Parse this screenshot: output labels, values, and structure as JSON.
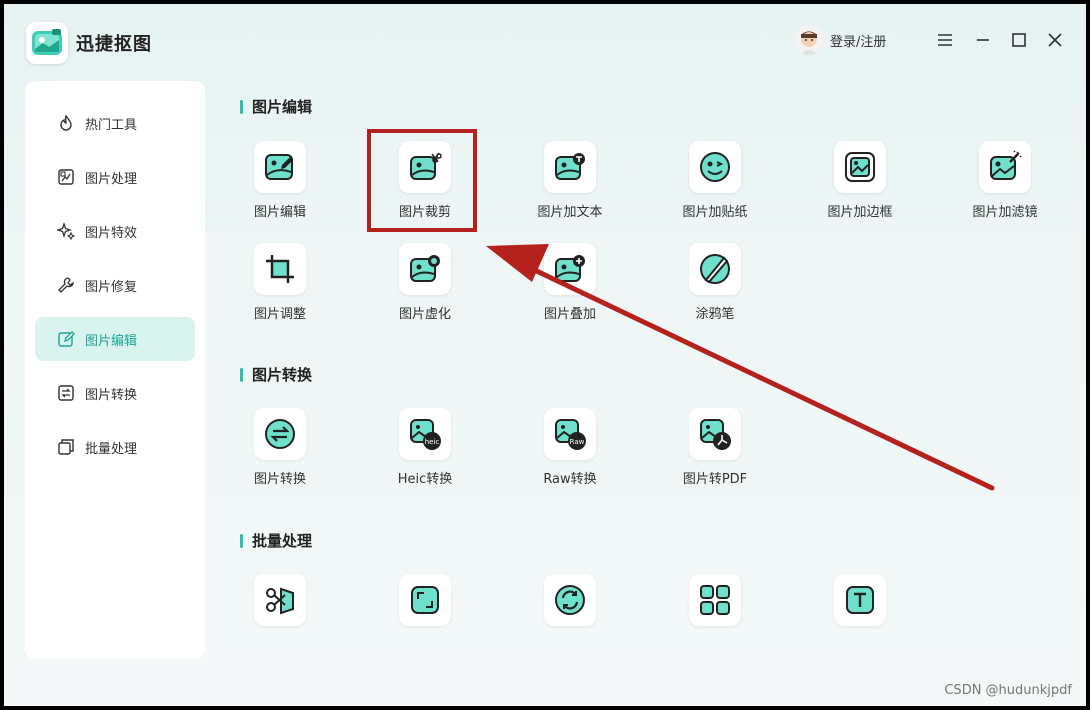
{
  "app": {
    "title": "迅捷抠图"
  },
  "header": {
    "login_label": "登录/注册"
  },
  "sidebar": {
    "items": [
      {
        "label": "热门工具",
        "icon": "flame-icon"
      },
      {
        "label": "图片处理",
        "icon": "image-process-icon"
      },
      {
        "label": "图片特效",
        "icon": "sparkle-icon"
      },
      {
        "label": "图片修复",
        "icon": "wrench-icon"
      },
      {
        "label": "图片编辑",
        "icon": "edit-icon",
        "active": true
      },
      {
        "label": "图片转换",
        "icon": "convert-icon"
      },
      {
        "label": "批量处理",
        "icon": "batch-icon"
      }
    ]
  },
  "sections": [
    {
      "title": "图片编辑",
      "tools": [
        {
          "label": "图片编辑",
          "icon": "image-edit-icon"
        },
        {
          "label": "图片裁剪",
          "icon": "image-crop-icon"
        },
        {
          "label": "图片加文本",
          "icon": "image-add-text-icon"
        },
        {
          "label": "图片加贴纸",
          "icon": "sticker-icon"
        },
        {
          "label": "图片加边框",
          "icon": "image-border-icon"
        },
        {
          "label": "图片加滤镜",
          "icon": "image-filter-icon"
        },
        {
          "label": "图片调整",
          "icon": "crop-adjust-icon"
        },
        {
          "label": "图片虚化",
          "icon": "image-blur-icon"
        },
        {
          "label": "图片叠加",
          "icon": "image-overlay-icon"
        },
        {
          "label": "涂鸦笔",
          "icon": "brush-icon"
        }
      ]
    },
    {
      "title": "图片转换",
      "tools": [
        {
          "label": "图片转换",
          "icon": "convert-circle-icon"
        },
        {
          "label": "Heic转换",
          "icon": "heic-icon",
          "badge": "heic"
        },
        {
          "label": "Raw转换",
          "icon": "raw-icon",
          "badge": "Raw"
        },
        {
          "label": "图片转PDF",
          "icon": "pdf-icon"
        }
      ]
    },
    {
      "title": "批量处理",
      "tools": [
        {
          "label": "",
          "icon": "batch-cutout-icon"
        },
        {
          "label": "",
          "icon": "batch-resize-icon"
        },
        {
          "label": "",
          "icon": "batch-rotate-icon"
        },
        {
          "label": "",
          "icon": "batch-grid-icon"
        },
        {
          "label": "",
          "icon": "batch-text-icon"
        }
      ]
    }
  ],
  "annotation": {
    "highlight_color": "#b5221d"
  },
  "theme": {
    "accent": "#2dc0ad",
    "active_bg": "#d9f4ef"
  },
  "watermark": "CSDN @hudunkjpdf"
}
